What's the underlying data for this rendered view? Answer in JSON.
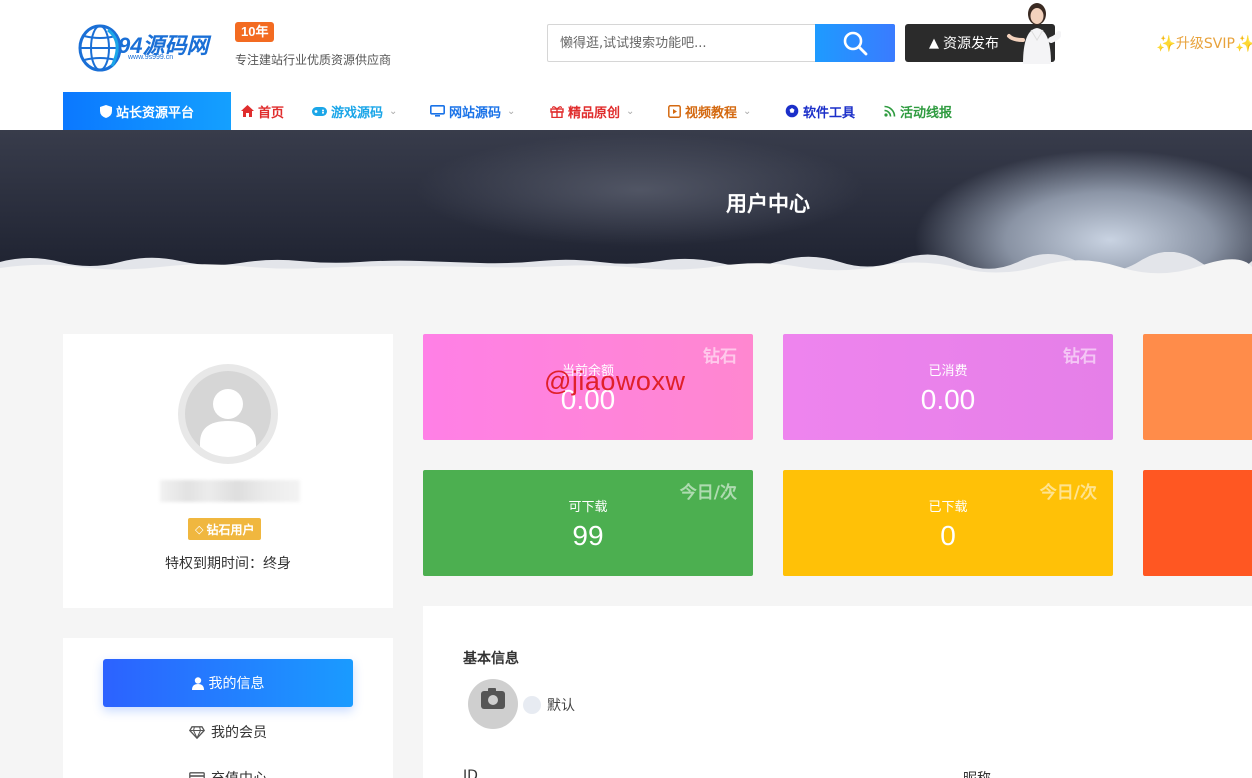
{
  "header": {
    "logo_text": "94源码网",
    "logo_url": "www.9s999.cn",
    "years_badge": "10年",
    "tagline": "专注建站行业优质资源供应商",
    "search": {
      "placeholder": "懒得逛,试试搜索功能吧..."
    },
    "publish_label": "资源发布",
    "svip_label": "升级SVIP"
  },
  "nav": {
    "platform_label": "站长资源平台",
    "items": [
      {
        "label": "首页",
        "icon": "home-icon",
        "color": "#e02d2d",
        "dropdown": false
      },
      {
        "label": "游戏源码",
        "icon": "gamepad-icon",
        "color": "#1ba6e8",
        "dropdown": true
      },
      {
        "label": "网站源码",
        "icon": "monitor-icon",
        "color": "#1a73e8",
        "dropdown": true
      },
      {
        "label": "精品原创",
        "icon": "gift-icon",
        "color": "#e02d2d",
        "dropdown": true
      },
      {
        "label": "视频教程",
        "icon": "video-icon",
        "color": "#d46a12",
        "dropdown": true
      },
      {
        "label": "软件工具",
        "icon": "football-icon",
        "color": "#1b2fc9",
        "dropdown": false
      },
      {
        "label": "活动线报",
        "icon": "rss-icon",
        "color": "#2e9b3f",
        "dropdown": false
      }
    ]
  },
  "banner": {
    "title": "用户中心"
  },
  "profile": {
    "vip_label": "钻石用户",
    "expiry_label": "特权到期时间：终身"
  },
  "menu": {
    "items": [
      {
        "label": "我的信息",
        "icon": "user-icon"
      },
      {
        "label": "我的会员",
        "icon": "diamond-icon"
      },
      {
        "label": "充值中心",
        "icon": "card-icon"
      }
    ]
  },
  "stats": [
    {
      "label": "当前余额",
      "value": "0.00",
      "corner": "钻石",
      "color": "#ff7fe0"
    },
    {
      "label": "已消费",
      "value": "0.00",
      "corner": "钻石",
      "color": "#e580e8"
    },
    {
      "label": "",
      "value": "",
      "corner": "",
      "color": "#ff8c4a"
    },
    {
      "label": "可下载",
      "value": "99",
      "corner": "今日/次",
      "color": "#4caf50"
    },
    {
      "label": "已下载",
      "value": "0",
      "corner": "今日/次",
      "color": "#ffc107"
    },
    {
      "label": "",
      "value": "",
      "corner": "",
      "color": "#ff5722"
    }
  ],
  "watermark": "@jiaowoxw",
  "info": {
    "title": "基本信息",
    "avatar_option": "默认",
    "id_label": "ID",
    "nickname_label": "昵称"
  }
}
